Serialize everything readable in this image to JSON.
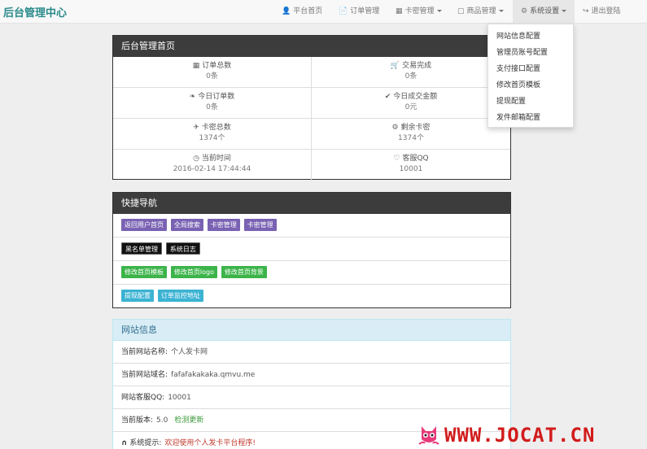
{
  "app": {
    "title": "后台管理中心"
  },
  "nav": {
    "items": [
      {
        "label": "平台首页",
        "icon": "user-icon"
      },
      {
        "label": "订单管理",
        "icon": "document-icon"
      },
      {
        "label": "卡密管理",
        "icon": "list-icon"
      },
      {
        "label": "商品管理",
        "icon": "card-icon"
      },
      {
        "label": "系统设置",
        "icon": "gear-icon"
      },
      {
        "label": "退出登陆",
        "icon": "logout-icon"
      }
    ]
  },
  "dropdown": {
    "items": [
      "网站信息配置",
      "管理员账号配置",
      "支付接口配置",
      "修改首页模板",
      "提现配置",
      "发件邮箱配置"
    ]
  },
  "dashboard": {
    "title": "后台管理首页",
    "stats": [
      {
        "label": "订单总数",
        "value": "0条",
        "icon": "grid-icon"
      },
      {
        "label": "交易完成",
        "value": "0条",
        "icon": "cart-icon"
      },
      {
        "label": "今日订单数",
        "value": "0条",
        "icon": "leaf-icon"
      },
      {
        "label": "今日成交金额",
        "value": "0元",
        "icon": "check-icon"
      },
      {
        "label": "卡密总数",
        "value": "1374个",
        "icon": "plane-icon"
      },
      {
        "label": "剩余卡密",
        "value": "1374个",
        "icon": "gear-icon"
      },
      {
        "label": "当前时间",
        "value": "2016-02-14 17:44:44",
        "icon": "clock-icon"
      },
      {
        "label": "客服QQ",
        "value": "10001",
        "icon": "heart-icon"
      }
    ]
  },
  "quick": {
    "title": "快捷导航",
    "rows": [
      [
        {
          "label": "返回用户首页",
          "color": "purple"
        },
        {
          "label": "全局搜索",
          "color": "purple"
        },
        {
          "label": "卡密管理",
          "color": "purple"
        },
        {
          "label": "卡密管理",
          "color": "purple"
        }
      ],
      [
        {
          "label": "黑名单管理",
          "color": "black"
        },
        {
          "label": "系统日志",
          "color": "black"
        }
      ],
      [
        {
          "label": "修改首页模板",
          "color": "green"
        },
        {
          "label": "修改首页logo",
          "color": "green"
        },
        {
          "label": "修改首页背景",
          "color": "green"
        }
      ],
      [
        {
          "label": "提现配置",
          "color": "cyan"
        },
        {
          "label": "订单监控地址",
          "color": "cyan"
        }
      ]
    ]
  },
  "site_info": {
    "title": "网站信息",
    "rows": [
      {
        "label": "当前网站名称:",
        "value": "个人发卡网"
      },
      {
        "label": "当前网站域名:",
        "value": "fafafakakaka.qmvu.me"
      },
      {
        "label": "网站客服QQ:",
        "value": "10001"
      },
      {
        "label": "当前版本:",
        "value": "5.0",
        "link": "检测更新"
      },
      {
        "label": "系统提示:",
        "value": "欢迎使用个人发卡平台程序!"
      }
    ]
  },
  "watermark": {
    "text": "WWW.JOCAT.CN"
  }
}
